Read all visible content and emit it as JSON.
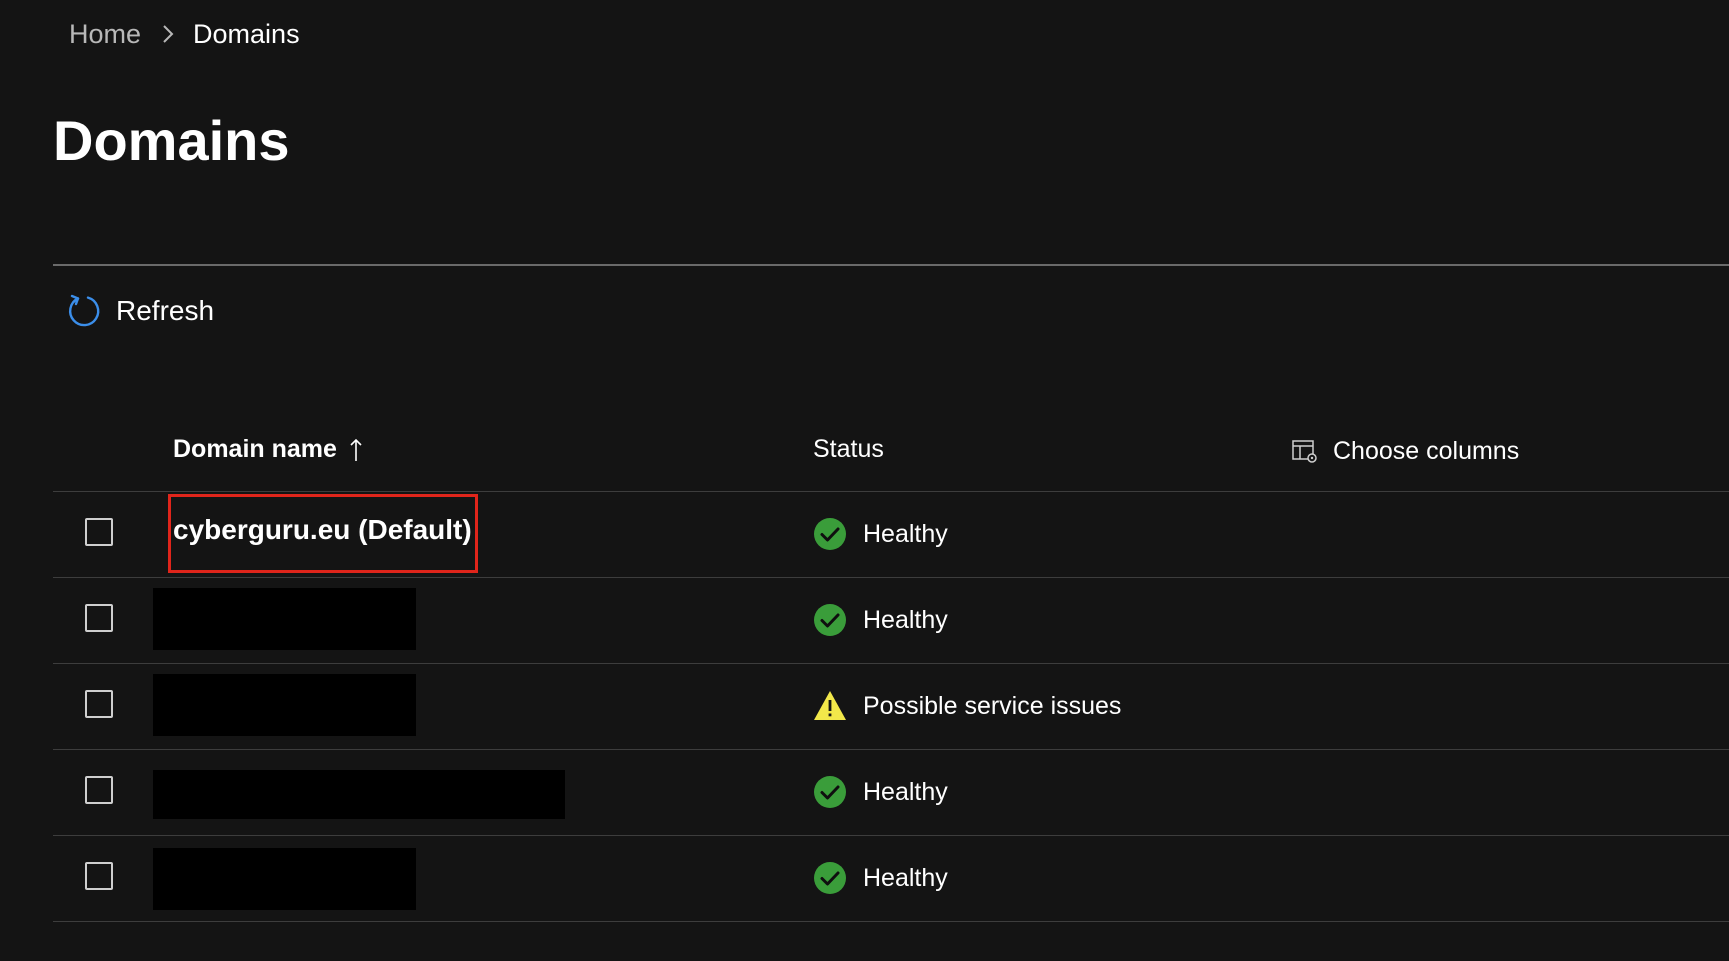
{
  "breadcrumb": {
    "home": "Home",
    "current": "Domains"
  },
  "page": {
    "title": "Domains"
  },
  "toolbar": {
    "refresh_label": "Refresh",
    "refresh_icon": "refresh-icon"
  },
  "table": {
    "columns": {
      "domain_name": "Domain name",
      "status": "Status",
      "choose_columns": "Choose columns"
    },
    "sort": {
      "column": "Domain name",
      "direction": "ascending"
    },
    "rows": [
      {
        "domain": "cyberguru.eu (Default)",
        "redacted": false,
        "highlighted": true,
        "status": "Healthy",
        "status_icon": "check-circle-icon",
        "checked": false
      },
      {
        "domain": "",
        "redacted": true,
        "highlighted": false,
        "status": "Healthy",
        "status_icon": "check-circle-icon",
        "checked": false
      },
      {
        "domain": "",
        "redacted": true,
        "highlighted": false,
        "status": "Possible service issues",
        "status_icon": "warning-icon",
        "checked": false
      },
      {
        "domain": "",
        "redacted": true,
        "highlighted": false,
        "status": "Healthy",
        "status_icon": "check-circle-icon",
        "checked": false
      },
      {
        "domain": "",
        "redacted": true,
        "highlighted": false,
        "status": "Healthy",
        "status_icon": "check-circle-icon",
        "checked": false
      }
    ]
  },
  "colors": {
    "background": "#141414",
    "healthy": "#3a9d3a",
    "warning": "#f2e84a",
    "highlight": "#e0251b",
    "refresh_accent": "#3b8eea"
  }
}
